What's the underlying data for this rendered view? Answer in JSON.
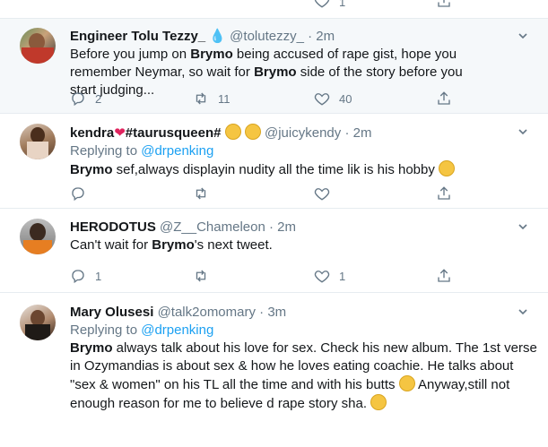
{
  "top_bar": {
    "count": "1"
  },
  "tweets": [
    {
      "name": "Engineer Tolu Tezzy_",
      "name_emoji": "💧",
      "handle": "@tolutezzy_",
      "dot": "·",
      "time": "2m",
      "text_before": "Before you jump on ",
      "bold1": "Brymo",
      "text_mid": " being accused of rape gist, hope you remember Neymar, so wait for ",
      "bold2": "Brymo",
      "text_after": " side of the story before you start judging...",
      "replies": "2",
      "retweets": "11",
      "likes": "40"
    },
    {
      "name": "kendra",
      "name_suffix": "#taurusqueen#",
      "handle": "@juicykendy",
      "dot": "·",
      "time": "2m",
      "replying_label": "Replying to ",
      "replying_to": "@drpenking",
      "bold1": "Brymo",
      "text_after": " sef,always displayin nudity all the time lik is his hobby"
    },
    {
      "name": "HERODOTUS",
      "handle": "@Z__Chameleon",
      "dot": "·",
      "time": "2m",
      "text_before": "Can't wait for ",
      "bold1": "Brymo",
      "text_after": "'s next tweet.",
      "replies": "1",
      "likes": "1"
    },
    {
      "name": "Mary Olusesi",
      "handle": "@talk2omomary",
      "dot": "·",
      "time": "3m",
      "replying_label": "Replying to ",
      "replying_to": "@drpenking",
      "bold1": "Brymo",
      "line1": " always talk about his love for sex. Check his new album. The 1st verse",
      "line2": "in Ozymandias is about sex & how he loves eating coachie. He talks about",
      "line3": "\"sex & women\" on his TL all the time and with his butts",
      "line3b": " Anyway,still not",
      "line4": "enough reason for me to believe d rape story sha."
    }
  ],
  "colors": {
    "accent": "#1da1f2",
    "muted": "#657786",
    "highlight_bg": "#f5f8fa",
    "border": "#e6ecf0"
  }
}
